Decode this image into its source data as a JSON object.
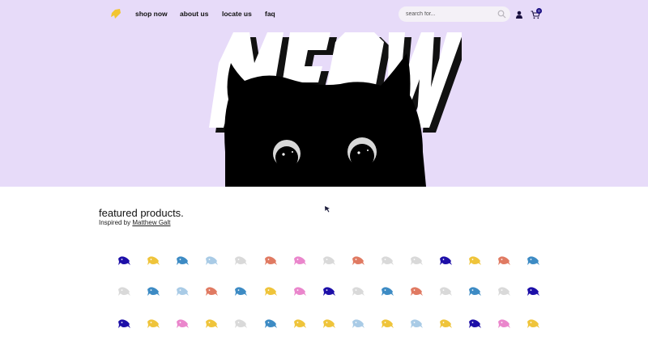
{
  "nav": {
    "links": [
      "shop now",
      "about us",
      "locate us",
      "faq"
    ],
    "search_placeholder": "search for...",
    "cart_count": "0",
    "icons": {
      "logo": "fish-logo-icon",
      "search": "search-icon",
      "user": "user-icon",
      "cart": "cart-icon"
    }
  },
  "hero": {
    "headline": "MEOW",
    "background_color": "#e7dbf9"
  },
  "featured": {
    "title": "featured products.",
    "credit_prefix": "Inspired by",
    "credit_link": "Matthew Galt"
  },
  "products": {
    "icon": "fish-icon",
    "colors": {
      "navy": "#1d0fa8",
      "yellow": "#efc43a",
      "lightblue": "#a9cbe6",
      "grey": "#d9d9d9",
      "salmon": "#e07a62",
      "pink": "#ea86cc",
      "blue": "#3d8bc4"
    },
    "rows": [
      [
        "navy",
        "yellow",
        "blue",
        "lightblue",
        "grey",
        "salmon",
        "pink",
        "grey",
        "salmon",
        "grey",
        "grey",
        "navy",
        "yellow",
        "salmon",
        "blue"
      ],
      [
        "grey",
        "blue",
        "lightblue",
        "salmon",
        "blue",
        "yellow",
        "pink",
        "navy",
        "grey",
        "blue",
        "salmon",
        "grey",
        "blue",
        "grey",
        "navy"
      ],
      [
        "navy",
        "yellow",
        "pink",
        "yellow",
        "grey",
        "blue",
        "yellow",
        "yellow",
        "lightblue",
        "yellow",
        "lightblue",
        "yellow",
        "navy",
        "pink",
        "yellow"
      ]
    ]
  }
}
